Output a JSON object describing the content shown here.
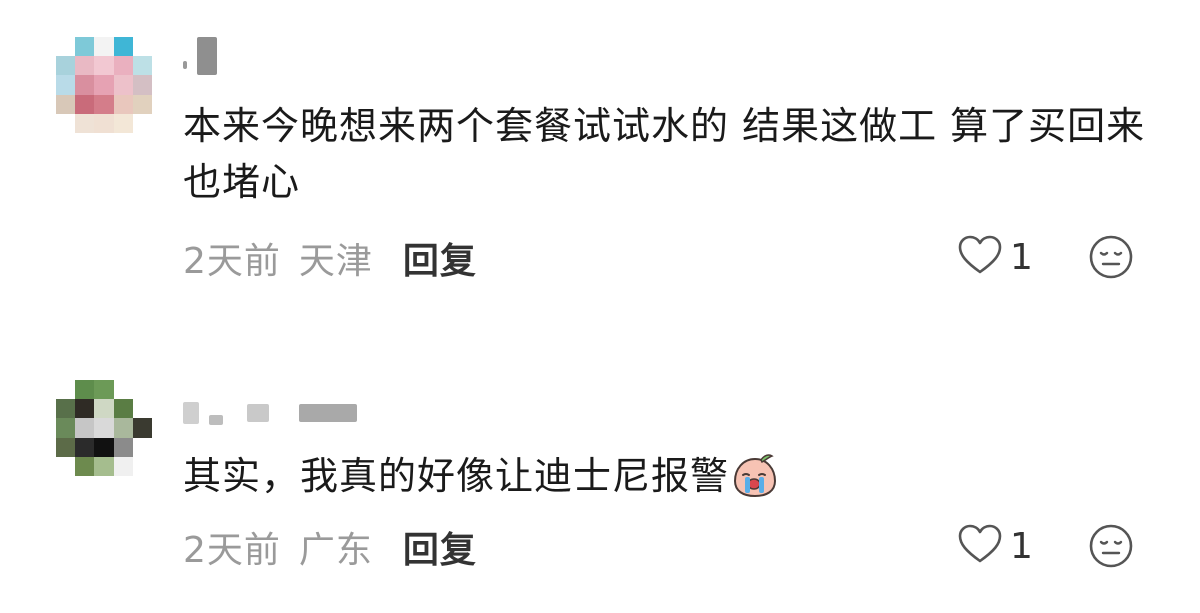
{
  "comments": [
    {
      "username_hidden": true,
      "text": "本来今晚想来两个套餐试试水的 结果这做工 算了买回来也堵心",
      "time": "2天前",
      "location": "天津",
      "reply_label": "回复",
      "like_count": "1"
    },
    {
      "username_hidden": true,
      "text": "其实，我真的好像让迪士尼报警",
      "emoji": "crying-peach-emoji",
      "time": "2天前",
      "location": "广东",
      "reply_label": "回复",
      "like_count": "1"
    }
  ],
  "colors": {
    "text": "#1a1a1a",
    "meta": "#9a9a9a",
    "reply": "#333333",
    "icon": "#555555"
  }
}
